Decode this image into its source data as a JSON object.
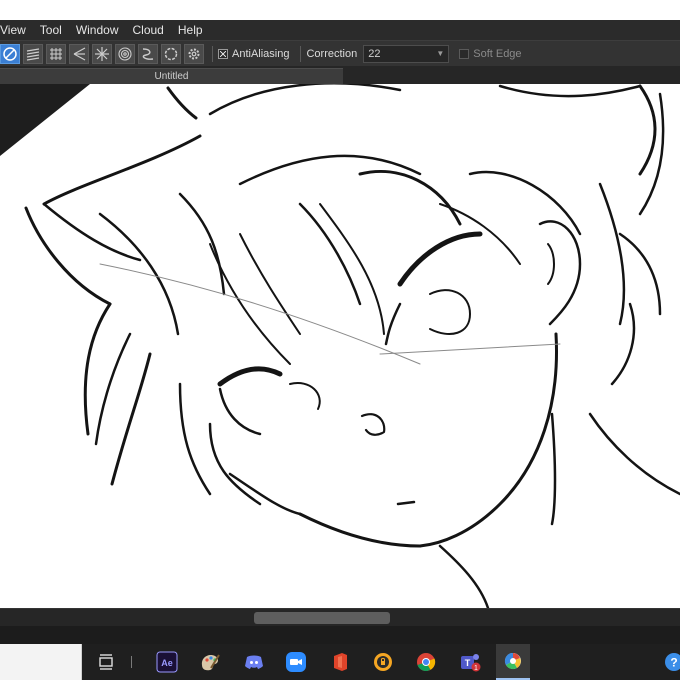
{
  "menu": {
    "items": [
      {
        "label": "View"
      },
      {
        "label": "Tool"
      },
      {
        "label": "Window"
      },
      {
        "label": "Cloud"
      },
      {
        "label": "Help"
      }
    ]
  },
  "toolbar": {
    "antialiasing_label": "AntiAliasing",
    "antialiasing_checked": true,
    "correction_label": "Correction",
    "correction_value": "22",
    "soft_edge_label": "Soft Edge",
    "soft_edge_checked": false
  },
  "document": {
    "tab_title": "Untitled"
  },
  "taskbar": {
    "ae_label": "Ae",
    "teams_badge": "1",
    "help_label": "?"
  },
  "colors": {
    "accent": "#3b7fd4",
    "menubar": "#2b2b2b",
    "toolbar": "#333333",
    "taskbar": "#1f1f1f"
  }
}
